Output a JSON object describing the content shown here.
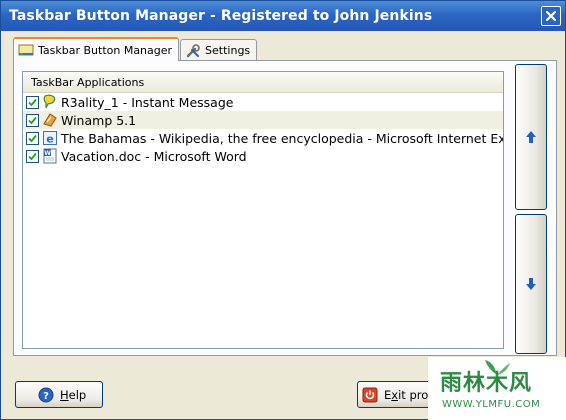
{
  "window": {
    "title": "Taskbar Button Manager - Registered to John Jenkins"
  },
  "tabs": [
    {
      "label": "Taskbar Button Manager",
      "icon": "taskbar-icon",
      "active": true
    },
    {
      "label": "Settings",
      "icon": "tools-icon",
      "active": false
    }
  ],
  "list": {
    "header": "TaskBar Applications",
    "items": [
      {
        "label": "R3ality_1 - Instant Message",
        "checked": true,
        "icon": "messenger-icon",
        "selected": false
      },
      {
        "label": "Winamp 5.1",
        "checked": true,
        "icon": "winamp-icon",
        "selected": true
      },
      {
        "label": "The Bahamas - Wikipedia, the free encyclopedia - Microsoft Internet Explorer",
        "checked": true,
        "icon": "internet-explorer-icon",
        "selected": false
      },
      {
        "label": "Vacation.doc - Microsoft Word",
        "checked": true,
        "icon": "word-document-icon",
        "selected": false
      }
    ]
  },
  "buttons": {
    "move_up_icon": "arrow-up-icon",
    "move_down_icon": "arrow-down-icon",
    "help_label": "Help",
    "help_accel": "H",
    "help_rest": "elp",
    "exit_label": "Exit progr",
    "exit_accel": "x",
    "exit_pre": "E",
    "exit_rest": "it progr"
  },
  "watermark": {
    "big": "雨林木风",
    "small": "WWW.YLMFU.COM"
  },
  "colors": {
    "titlebar": "#2c66c4",
    "tab_highlight": "#e68b2c",
    "arrow_blue": "#1f5fbf",
    "watermark_green": "#2f8a46"
  }
}
